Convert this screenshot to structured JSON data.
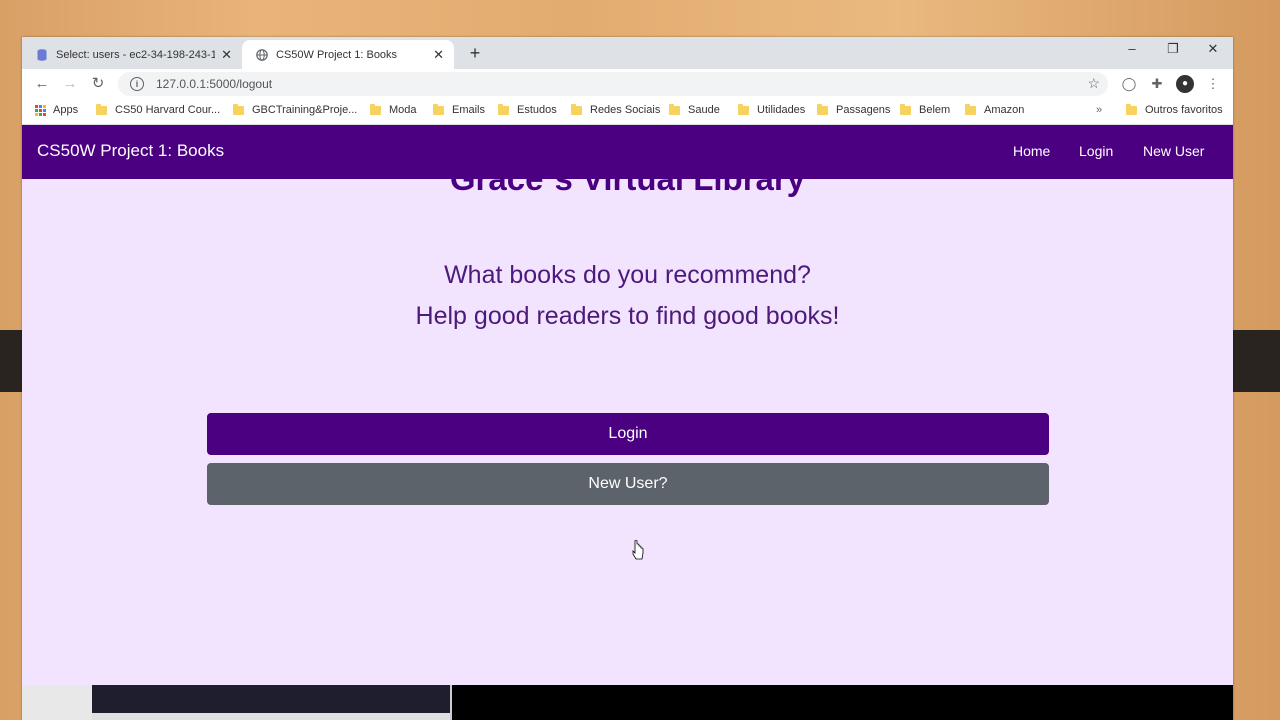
{
  "browser": {
    "tabs": [
      {
        "title": "Select: users - ec2-34-198-243-1…",
        "active": false,
        "icon": "database-icon"
      },
      {
        "title": "CS50W Project 1: Books",
        "active": true,
        "icon": "globe-icon"
      }
    ],
    "address": "127.0.0.1:5000/logout",
    "bookmarks": [
      "Apps",
      "CS50 Harvard Cour...",
      "GBCTraining&Proje...",
      "Moda",
      "Emails",
      "Estudos",
      "Redes Sociais",
      "Saude",
      "Utilidades",
      "Passagens",
      "Belem",
      "Amazon"
    ],
    "other_bookmarks": "Outros favoritos"
  },
  "navbar": {
    "brand": "CS50W Project 1: Books",
    "links": [
      "Home",
      "Login",
      "New User"
    ]
  },
  "main": {
    "title": "Grace´s Virtual Library",
    "subtitle_line1": "What books do you recommend?",
    "subtitle_line2": "Help good readers to find good books!",
    "login_button": "Login",
    "new_user_button": "New User?"
  },
  "colors": {
    "primary": "#4b0082",
    "secondary": "#5c636a",
    "background": "#f2e4ff"
  }
}
